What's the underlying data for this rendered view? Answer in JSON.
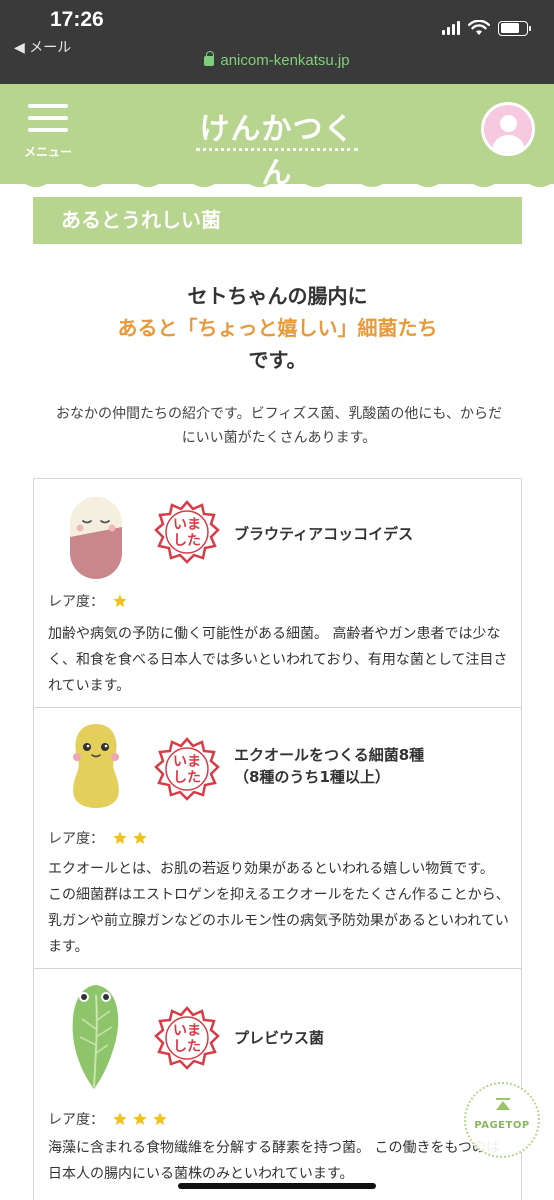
{
  "status_bar": {
    "time": "17:26",
    "back_label": "◀ メール"
  },
  "browser": {
    "url": "anicom-kenkatsu.jp"
  },
  "header": {
    "menu_label": "メニュー",
    "logo_text": "けんかつくん",
    "accent_color": "#b8d58f"
  },
  "section": {
    "title": "あるとうれしい菌"
  },
  "intro": {
    "line1": "セトちゃんの腸内に",
    "line2": "あると「ちょっと嬉しい」細菌たち",
    "line3": "です。",
    "highlight_color": "#e89a3b",
    "description": "おなかの仲間たちの紹介です。ビフィズス菌、乳酸菌の他にも、からだにいい菌がたくさんあります。"
  },
  "cards": [
    {
      "stamp_text": "いました",
      "name": "ブラウティアコッコイデス",
      "rarity_label": "レア度：",
      "rarity_stars": 1,
      "character_icon": "capsule-character-icon",
      "text": "加齢や病気の予防に働く可能性がある細菌。 高齢者やガン患者では少なく、和食を食べる日本人では多いといわれており、有用な菌として注目されています。"
    },
    {
      "stamp_text": "いました",
      "name_line1": "エクオールをつくる細菌8種",
      "name_line2": "（8種のうち1種以上）",
      "rarity_label": "レア度：",
      "rarity_stars": 2,
      "character_icon": "peanut-character-icon",
      "text": "エクオールとは、お肌の若返り効果があるといわれる嬉しい物質です。 この細菌群はエストロゲンを抑えるエクオールをたくさん作ることから、 乳ガンや前立腺ガンなどのホルモン性の病気予防効果があるといわれています。"
    },
    {
      "stamp_text": "いました",
      "name": "プレビウス菌",
      "rarity_label": "レア度：",
      "rarity_stars": 3,
      "character_icon": "leaf-character-icon",
      "text": "海藻に含まれる食物繊維を分解する酵素を持つ菌。 この働きをもつのは日本人の腸内にいる菌株のみといわれています。"
    }
  ],
  "pagetop": {
    "label": "PAGETOP"
  },
  "colors": {
    "star": "#f2c21c",
    "stamp": "#d93b46"
  }
}
